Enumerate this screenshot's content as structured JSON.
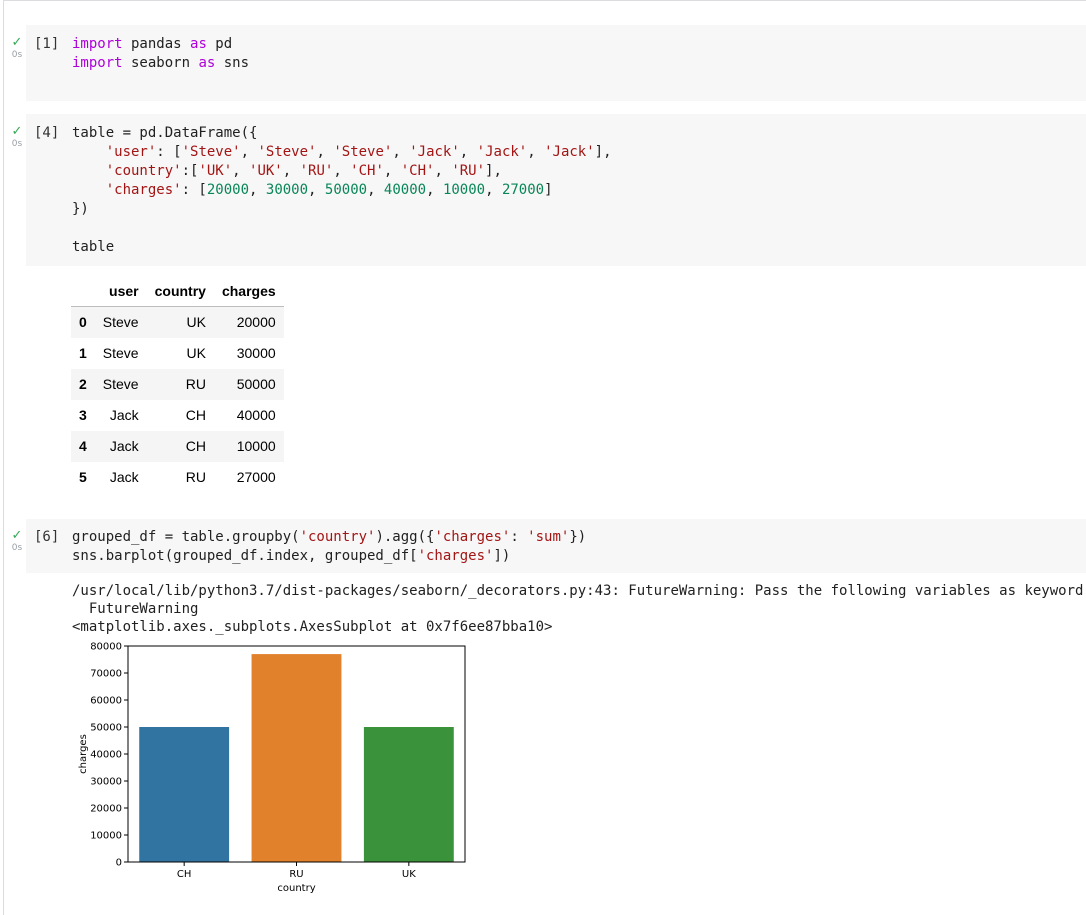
{
  "cells": [
    {
      "prompt": "[1]",
      "status_icon": "check-icon",
      "time": "0s",
      "code_lines": [
        [
          {
            "t": "import",
            "c": "kw"
          },
          {
            "t": " pandas "
          },
          {
            "t": "as",
            "c": "kw"
          },
          {
            "t": " pd"
          }
        ],
        [
          {
            "t": "import",
            "c": "kw"
          },
          {
            "t": " seaborn "
          },
          {
            "t": "as",
            "c": "kw"
          },
          {
            "t": " sns"
          }
        ]
      ]
    },
    {
      "prompt": "[4]",
      "status_icon": "check-icon",
      "time": "0s",
      "code_lines": [
        [
          {
            "t": "table = pd.DataFrame({"
          }
        ],
        [
          {
            "t": "    "
          },
          {
            "t": "'user'",
            "c": "st"
          },
          {
            "t": ": ["
          },
          {
            "t": "'Steve'",
            "c": "st"
          },
          {
            "t": ", "
          },
          {
            "t": "'Steve'",
            "c": "st"
          },
          {
            "t": ", "
          },
          {
            "t": "'Steve'",
            "c": "st"
          },
          {
            "t": ", "
          },
          {
            "t": "'Jack'",
            "c": "st"
          },
          {
            "t": ", "
          },
          {
            "t": "'Jack'",
            "c": "st"
          },
          {
            "t": ", "
          },
          {
            "t": "'Jack'",
            "c": "st"
          },
          {
            "t": "],"
          }
        ],
        [
          {
            "t": "    "
          },
          {
            "t": "'country'",
            "c": "st"
          },
          {
            "t": ":["
          },
          {
            "t": "'UK'",
            "c": "st"
          },
          {
            "t": ", "
          },
          {
            "t": "'UK'",
            "c": "st"
          },
          {
            "t": ", "
          },
          {
            "t": "'RU'",
            "c": "st"
          },
          {
            "t": ", "
          },
          {
            "t": "'CH'",
            "c": "st"
          },
          {
            "t": ", "
          },
          {
            "t": "'CH'",
            "c": "st"
          },
          {
            "t": ", "
          },
          {
            "t": "'RU'",
            "c": "st"
          },
          {
            "t": "],"
          }
        ],
        [
          {
            "t": "    "
          },
          {
            "t": "'charges'",
            "c": "st"
          },
          {
            "t": ": ["
          },
          {
            "t": "20000",
            "c": "nm"
          },
          {
            "t": ", "
          },
          {
            "t": "30000",
            "c": "nm"
          },
          {
            "t": ", "
          },
          {
            "t": "50000",
            "c": "nm"
          },
          {
            "t": ", "
          },
          {
            "t": "40000",
            "c": "nm"
          },
          {
            "t": ", "
          },
          {
            "t": "10000",
            "c": "nm"
          },
          {
            "t": ", "
          },
          {
            "t": "27000",
            "c": "nm"
          },
          {
            "t": "]"
          }
        ],
        [
          {
            "t": "})"
          }
        ],
        [
          {
            "t": ""
          }
        ],
        [
          {
            "t": "table"
          }
        ]
      ]
    },
    {
      "prompt": "[6]",
      "status_icon": "check-icon",
      "time": "0s",
      "code_lines": [
        [
          {
            "t": "grouped_df = table.groupby("
          },
          {
            "t": "'country'",
            "c": "st"
          },
          {
            "t": ").agg({"
          },
          {
            "t": "'charges'",
            "c": "st"
          },
          {
            "t": ": "
          },
          {
            "t": "'sum'",
            "c": "st"
          },
          {
            "t": "})"
          }
        ],
        [
          {
            "t": "sns.barplot(grouped_df.index, grouped_df["
          },
          {
            "t": "'charges'",
            "c": "st"
          },
          {
            "t": "])"
          }
        ]
      ]
    }
  ],
  "dataframe": {
    "columns": [
      "user",
      "country",
      "charges"
    ],
    "rows": [
      [
        "0",
        "Steve",
        "UK",
        "20000"
      ],
      [
        "1",
        "Steve",
        "UK",
        "30000"
      ],
      [
        "2",
        "Steve",
        "RU",
        "50000"
      ],
      [
        "3",
        "Jack",
        "CH",
        "40000"
      ],
      [
        "4",
        "Jack",
        "CH",
        "10000"
      ],
      [
        "5",
        "Jack",
        "RU",
        "27000"
      ]
    ]
  },
  "output": {
    "stderr": "/usr/local/lib/python3.7/dist-packages/seaborn/_decorators.py:43: FutureWarning: Pass the following variables as keyword args: x, y.\n  FutureWarning",
    "repr": "<matplotlib.axes._subplots.AxesSubplot at 0x7f6ee87bba10>"
  },
  "chart_data": {
    "type": "bar",
    "categories": [
      "CH",
      "RU",
      "UK"
    ],
    "values": [
      50000,
      77000,
      50000
    ],
    "colors": [
      "#3274a1",
      "#e1812c",
      "#3a923a"
    ],
    "xlabel": "country",
    "ylabel": "charges",
    "ylim": [
      0,
      80000
    ],
    "yticks": [
      0,
      10000,
      20000,
      30000,
      40000,
      50000,
      60000,
      70000,
      80000
    ],
    "grid": false,
    "legend": false
  }
}
